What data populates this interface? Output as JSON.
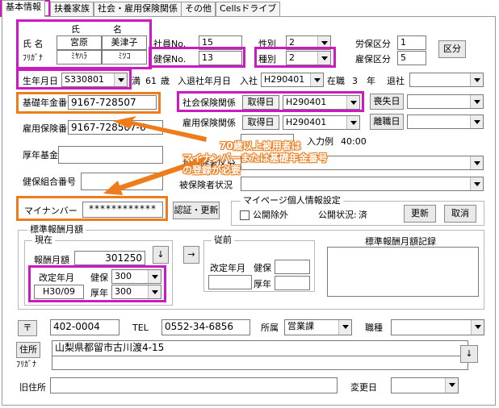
{
  "tabs": [
    "基本情報",
    "扶養家族",
    "社会・雇用保険関係",
    "その他",
    "Cellsドライブ"
  ],
  "name": {
    "col_last": "氏",
    "col_first": "名",
    "label_name": "氏 名",
    "label_kana": "ﾌﾘｶﾞﾅ",
    "last": "宮原",
    "first": "美津子",
    "kana_last": "ﾐﾔﾊﾗ",
    "kana_first": "ﾐﾂｺ"
  },
  "employee_no": {
    "label": "社員No.",
    "value": "15"
  },
  "health_no": {
    "label": "健保No.",
    "value": "13"
  },
  "gender": {
    "label": "性別",
    "value": "2"
  },
  "kind": {
    "label": "種別",
    "value": "2"
  },
  "labor_class": {
    "label": "労保区分",
    "value": "1"
  },
  "employ_class": {
    "label": "雇保区分",
    "value": "5"
  },
  "class_button": "区分",
  "birth": {
    "label": "生年月日",
    "value": "S330801",
    "age_prefix": "満",
    "age": "61",
    "age_suffix": "歳"
  },
  "hire": {
    "label": "入退社年月日",
    "in_label": "入社",
    "in_value": "H290401",
    "tenure_label": "在職",
    "tenure": "3",
    "tenure_unit": "年",
    "out_label": "退社",
    "out_value": ""
  },
  "pension_no": {
    "label": "基礎年金番号",
    "value": "9167-728507"
  },
  "social_ins": {
    "label": "社会保険関係",
    "acq_label": "取得日",
    "acq_value": "H290401",
    "loss_button": "喪失日",
    "loss_value": ""
  },
  "employment_ins_no": {
    "label": "雇用保険番号",
    "value": "9167-728507-6"
  },
  "employment_ins": {
    "label": "雇用保険関係",
    "acq_label": "取得日",
    "acq_value": "H290401",
    "leave_button": "離職日",
    "leave_value": ""
  },
  "input_example": {
    "label": "入力例",
    "value": "40:00"
  },
  "welfare_fund": {
    "label": "厚年基金番号",
    "value": ""
  },
  "health_union": {
    "label": "健保組合番号",
    "value": ""
  },
  "insured_class": {
    "label": "被保険者区分",
    "value": ""
  },
  "insured_status": {
    "label": "被保険者状況",
    "value": ""
  },
  "annotation": {
    "line1": "70歳以上被用者は",
    "line2": "マイナンバーまたは基礎年金番号",
    "line3": "の登録が必要"
  },
  "mynumber": {
    "label": "マイナンバー",
    "value": "************",
    "button": "認証・更新"
  },
  "myportal": {
    "title": "マイページ個人情報設定",
    "public_exclude": "公開除外",
    "status_label": "公開状況:",
    "status_value": "済",
    "update_button": "更新",
    "cancel_button": "取消"
  },
  "std_pay": {
    "title": "標準報酬月額",
    "current_title": "現在",
    "monthly_label": "報酬月額",
    "monthly_value": "301250",
    "down_button": "↓",
    "right_button": "→",
    "revised_label": "改定年月",
    "revised_value": "H30/09",
    "kenpo_label": "健保",
    "kenpo_value": "300",
    "kounen_label": "厚年",
    "kounen_value": "300",
    "prev_title": "従前",
    "prev_revised_label": "改定年月",
    "prev_kenpo_label": "健保",
    "prev_kounen_label": "厚年",
    "record_title": "標準報酬月額記録"
  },
  "address": {
    "postal_button": "〒",
    "postal": "402-0004",
    "tel_label": "TEL",
    "tel": "0552-34-6856",
    "dept_label": "所属",
    "dept": "営業課",
    "title_label": "職種",
    "title": "",
    "addr_button": "住所",
    "addr": "山梨県都留市古川渡4-15",
    "kana_label": "ﾌﾘｶﾞﾅ",
    "kana": "",
    "down_button": "↓",
    "old_label": "旧住所",
    "old": "",
    "changed_label": "変更日",
    "changed": ""
  }
}
